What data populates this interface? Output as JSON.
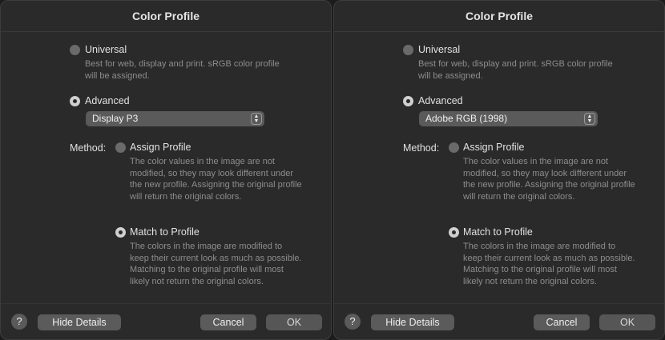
{
  "dialogs": [
    {
      "title": "Color Profile",
      "universal_label": "Universal",
      "universal_desc": "Best for web, display and print. sRGB color profile will be assigned.",
      "advanced_label": "Advanced",
      "profile_selected": "Display P3",
      "method_label": "Method:",
      "assign_label": "Assign Profile",
      "assign_desc": "The color values in the image are not modified, so they may look different under the new profile. Assigning the original profile will return the original colors.",
      "match_label": "Match to Profile",
      "match_desc": "The colors in the image are modified to keep their current look as much as possible. Matching to the original profile will most likely not return the original colors.",
      "help": "?",
      "hide_details": "Hide Details",
      "cancel": "Cancel",
      "ok": "OK"
    },
    {
      "title": "Color Profile",
      "universal_label": "Universal",
      "universal_desc": "Best for web, display and print. sRGB color profile will be assigned.",
      "advanced_label": "Advanced",
      "profile_selected": "Adobe RGB (1998)",
      "method_label": "Method:",
      "assign_label": "Assign Profile",
      "assign_desc": "The color values in the image are not modified, so they may look different under the new profile. Assigning the original profile will return the original colors.",
      "match_label": "Match to Profile",
      "match_desc": "The colors in the image are modified to keep their current look as much as possible. Matching to the original profile will most likely not return the original colors.",
      "help": "?",
      "hide_details": "Hide Details",
      "cancel": "Cancel",
      "ok": "OK"
    }
  ]
}
